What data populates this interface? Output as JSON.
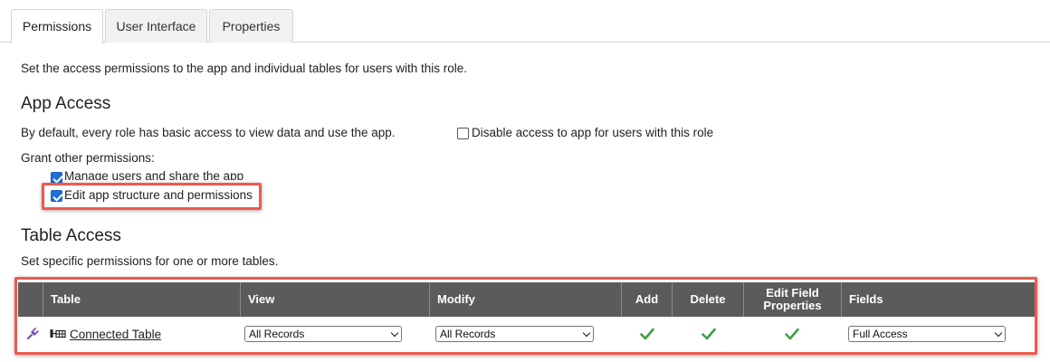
{
  "tabs": [
    {
      "label": "Permissions",
      "active": true
    },
    {
      "label": "User Interface",
      "active": false
    },
    {
      "label": "Properties",
      "active": false
    }
  ],
  "intro": "Set the access permissions to the app and individual tables for users with this role.",
  "app_access": {
    "heading": "App Access",
    "default_text": "By default, every role has basic access to view data and use the app.",
    "disable_label": "Disable access to app for users with this role",
    "disable_checked": false,
    "grant_label": "Grant other permissions:",
    "permissions": [
      {
        "label": "Manage users and share the app",
        "checked": true
      },
      {
        "label": "Edit app structure and permissions",
        "checked": true
      }
    ]
  },
  "table_access": {
    "heading": "Table Access",
    "subtext": "Set specific permissions for one or more tables.",
    "columns": {
      "table": "Table",
      "view": "View",
      "modify": "Modify",
      "add": "Add",
      "delete": "Delete",
      "edit_field_line1": "Edit Field",
      "edit_field_line2": "Properties",
      "fields": "Fields"
    },
    "rows": [
      {
        "table_name": "Connected Table",
        "view": "All Records",
        "modify": "All Records",
        "add": true,
        "delete": true,
        "edit_field_properties": true,
        "fields": "Full Access"
      }
    ]
  },
  "colors": {
    "accent_highlight": "#ec5a4f",
    "checkbox_blue": "#1f6fd6",
    "header_gray": "#5b5b5b",
    "check_green": "#3aa142",
    "plug_purple": "#7b47a6"
  }
}
